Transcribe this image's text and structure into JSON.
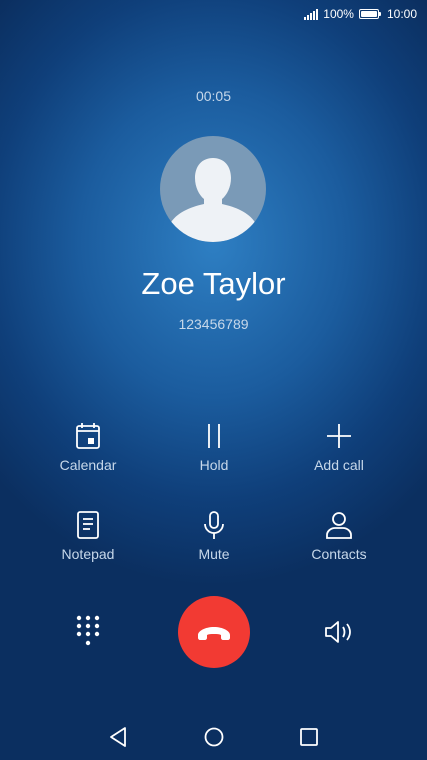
{
  "status_bar": {
    "battery_percent": "100%",
    "time": "10:00",
    "signal_icon": "signal-icon",
    "battery_icon": "battery-icon"
  },
  "call": {
    "timer": "00:05",
    "contact_name": "Zoe Taylor",
    "contact_number": "123456789",
    "avatar_icon": "person-silhouette-icon"
  },
  "actions": [
    {
      "label": "Calendar",
      "icon": "calendar-icon"
    },
    {
      "label": "Hold",
      "icon": "pause-icon"
    },
    {
      "label": "Add call",
      "icon": "plus-icon"
    },
    {
      "label": "Notepad",
      "icon": "notepad-icon"
    },
    {
      "label": "Mute",
      "icon": "microphone-icon"
    },
    {
      "label": "Contacts",
      "icon": "person-icon"
    }
  ],
  "bottom_controls": {
    "dialpad_icon": "dialpad-icon",
    "end_call_icon": "end-call-icon",
    "speaker_icon": "speaker-icon",
    "end_call_color": "#f23a33"
  },
  "nav_bar": {
    "back_icon": "back-triangle-icon",
    "home_icon": "home-circle-icon",
    "recents_icon": "recents-square-icon"
  }
}
